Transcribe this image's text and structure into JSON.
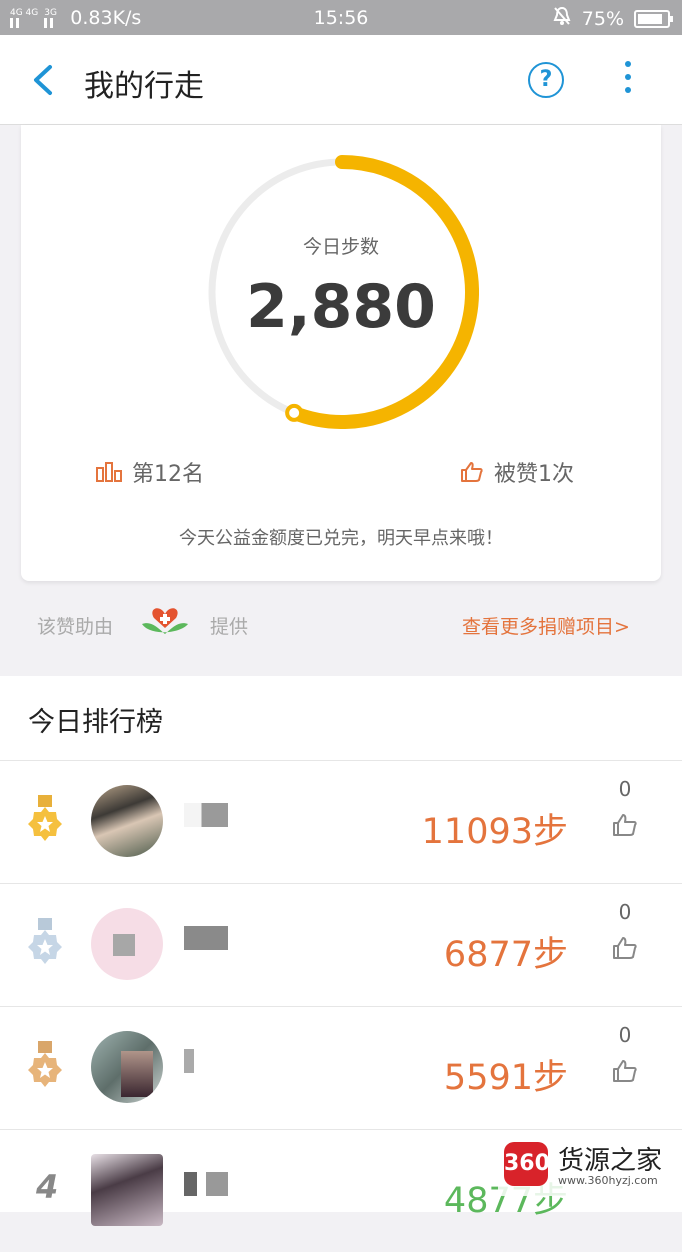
{
  "status_bar": {
    "network": "4G 4G",
    "network2": "3G",
    "speed": "0.83K/s",
    "time": "15:56",
    "battery": "75%"
  },
  "header": {
    "title": "我的行走",
    "help_symbol": "?"
  },
  "card": {
    "steps_label": "今日步数",
    "steps_value": "2,880",
    "progress_fraction": 0.56,
    "rank_text": "第12名",
    "likes_text": "被赞1次",
    "notice": "今天公益金额度已兑完，明天早点来哦！"
  },
  "sponsor": {
    "left_text": "该赞助由",
    "right_text": "提供",
    "more_link": "查看更多捐赠项目>"
  },
  "leaderboard": {
    "title": "今日排行榜",
    "rows": [
      {
        "rank": "1",
        "steps": "11093步",
        "likes": "0",
        "medal": "gold"
      },
      {
        "rank": "2",
        "steps": "6877步",
        "likes": "0",
        "medal": "silver"
      },
      {
        "rank": "3",
        "steps": "5591步",
        "likes": "0",
        "medal": "bronze"
      },
      {
        "rank": "4",
        "steps": "4877步",
        "likes": ""
      }
    ]
  },
  "watermark": {
    "badge": "360",
    "text": "货源之家",
    "url": "www.360hyzj.com"
  },
  "colors": {
    "accent_blue": "#1f94d6",
    "orange": "#e4743d",
    "ring_yellow": "#f5b400",
    "green": "#5cb85c"
  }
}
